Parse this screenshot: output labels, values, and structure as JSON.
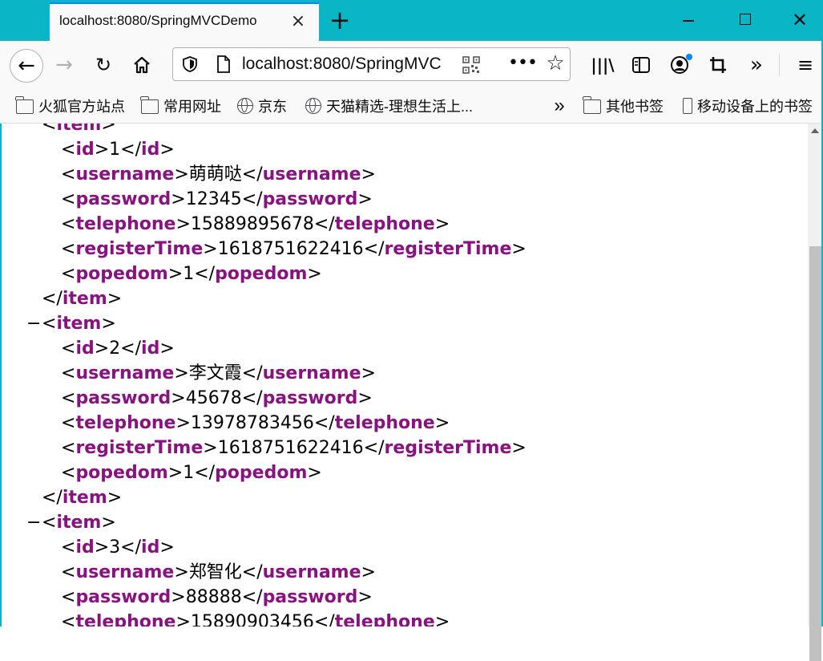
{
  "tab": {
    "title": "localhost:8080/SpringMVCDemo",
    "close_icon": "×",
    "new_tab_icon": "+"
  },
  "window": {
    "minimize": "minimize",
    "maximize": "maximize",
    "close_icon": "✕"
  },
  "nav": {
    "back_icon": "←",
    "forward_icon": "→",
    "reload_icon": "↻",
    "home_icon": "⌂",
    "url": "localhost:8080/SpringMVC",
    "page_actions_icon": "•••",
    "bookmark_star_icon": "☆",
    "library_icon": "|||\\",
    "sidebar_icon": "▥",
    "account_icon": "◉",
    "screenshot_icon": "⌗",
    "overflow_icon": "»",
    "menu_icon": "≡"
  },
  "bookmarks": {
    "items": [
      {
        "label": "火狐官方站点",
        "icon": "folder-icon"
      },
      {
        "label": "常用网址",
        "icon": "folder-icon"
      },
      {
        "label": "京东",
        "icon": "globe-icon"
      },
      {
        "label": "天猫精选-理想生活上...",
        "icon": "globe-icon"
      }
    ],
    "overflow_icon": "»",
    "other": "其他书签",
    "mobile": "移动设备上的书签"
  },
  "xml": {
    "collapse_symbol": "−",
    "tags": {
      "item": "item",
      "id": "id",
      "username": "username",
      "password": "password",
      "telephone": "telephone",
      "registerTime": "registerTime",
      "popedom": "popedom"
    },
    "items": [
      {
        "id": "1",
        "username": "萌萌哒",
        "password": "12345",
        "telephone": "15889895678",
        "registerTime": "1618751622416",
        "popedom": "1"
      },
      {
        "id": "2",
        "username": "李文霞",
        "password": "45678",
        "telephone": "13978783456",
        "registerTime": "1618751622416",
        "popedom": "1"
      },
      {
        "id": "3",
        "username": "郑智化",
        "password": "88888",
        "telephone": "15890903456"
      }
    ]
  },
  "colors": {
    "tab_strip": "#0ab5c5",
    "tag": "#881280",
    "accent": "#0a84ff"
  }
}
